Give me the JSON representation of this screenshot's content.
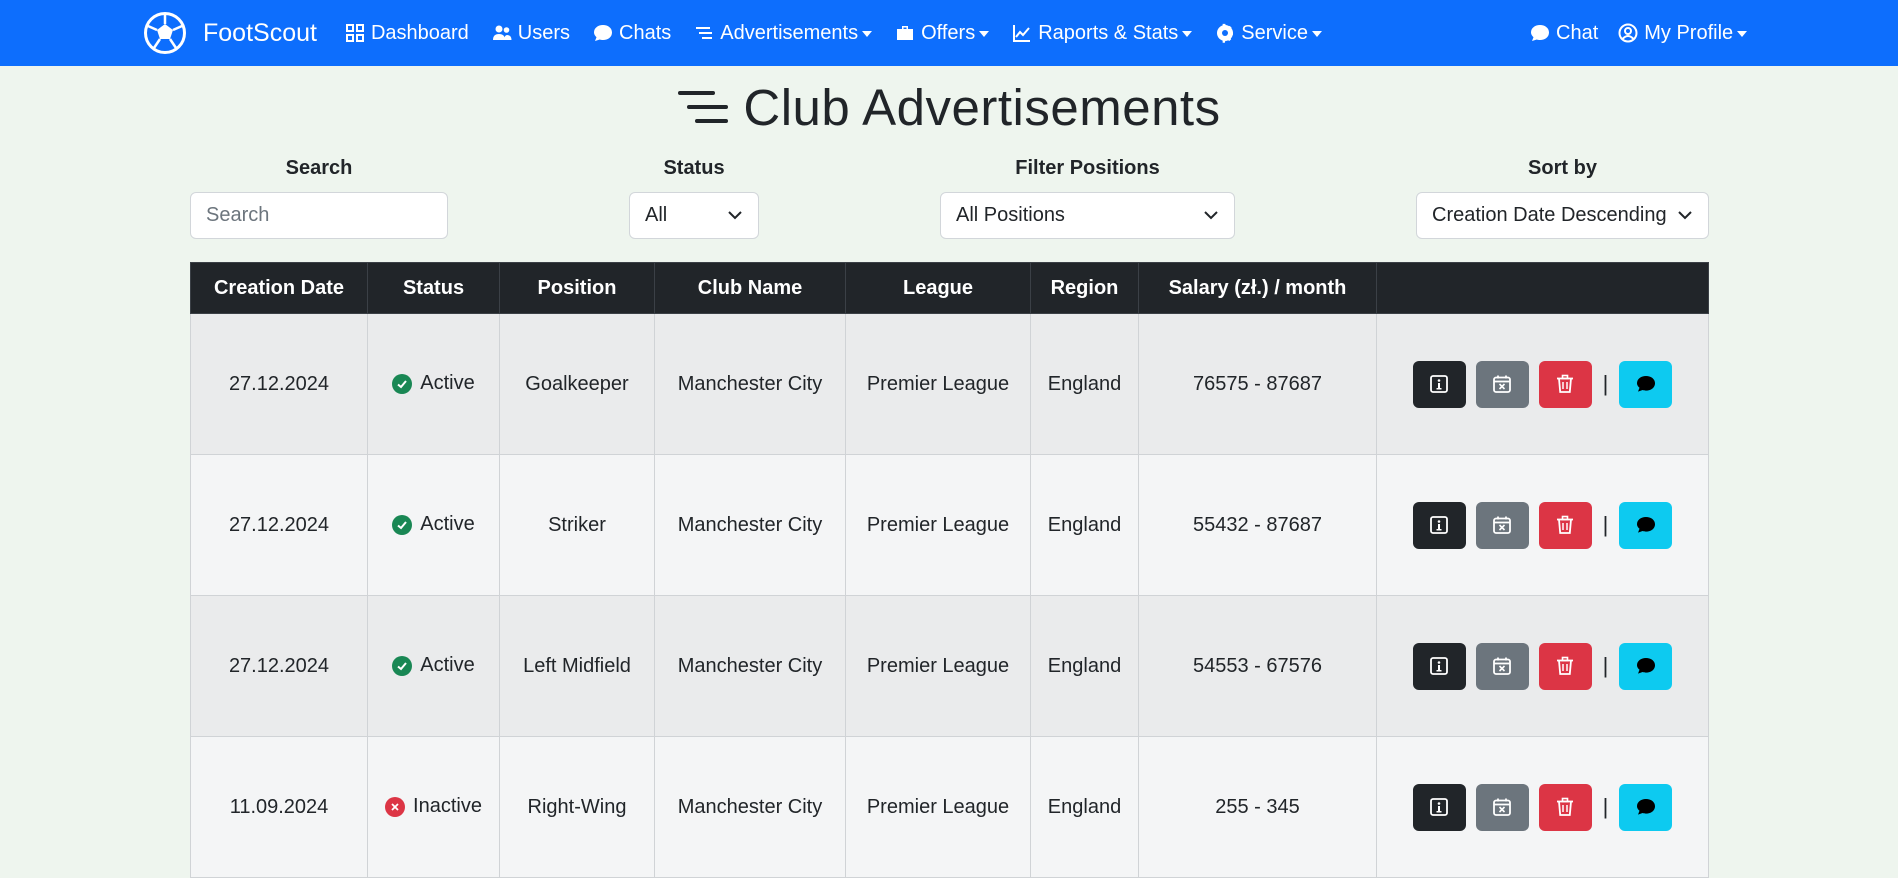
{
  "brand": {
    "name": "FootScout"
  },
  "nav": {
    "items": [
      {
        "label": "Dashboard",
        "icon": "grid-icon",
        "dropdown": false
      },
      {
        "label": "Users",
        "icon": "users-icon",
        "dropdown": false
      },
      {
        "label": "Chats",
        "icon": "chat-icon",
        "dropdown": false
      },
      {
        "label": "Advertisements",
        "icon": "list-icon",
        "dropdown": true
      },
      {
        "label": "Offers",
        "icon": "briefcase-icon",
        "dropdown": true
      },
      {
        "label": "Raports & Stats",
        "icon": "chart-icon",
        "dropdown": true
      },
      {
        "label": "Service",
        "icon": "gear-icon",
        "dropdown": true
      }
    ],
    "right": [
      {
        "label": "Chat",
        "icon": "chat-icon",
        "dropdown": false
      },
      {
        "label": "My Profile",
        "icon": "user-circle-icon",
        "dropdown": true
      }
    ]
  },
  "page": {
    "title": "Club Advertisements"
  },
  "filters": {
    "search": {
      "label": "Search",
      "placeholder": "Search",
      "value": ""
    },
    "status": {
      "label": "Status",
      "value": "All"
    },
    "positions": {
      "label": "Filter Positions",
      "value": "All Positions"
    },
    "sort": {
      "label": "Sort by",
      "value": "Creation Date Descending"
    }
  },
  "table": {
    "headers": [
      "Creation Date",
      "Status",
      "Position",
      "Club Name",
      "League",
      "Region",
      "Salary (zł.) / month",
      ""
    ],
    "rows": [
      {
        "date": "27.12.2024",
        "status": "Active",
        "active": true,
        "position": "Goalkeeper",
        "club": "Manchester City",
        "league": "Premier League",
        "region": "England",
        "salary": "76575 - 87687"
      },
      {
        "date": "27.12.2024",
        "status": "Active",
        "active": true,
        "position": "Striker",
        "club": "Manchester City",
        "league": "Premier League",
        "region": "England",
        "salary": "55432 - 87687"
      },
      {
        "date": "27.12.2024",
        "status": "Active",
        "active": true,
        "position": "Left Midfield",
        "club": "Manchester City",
        "league": "Premier League",
        "region": "England",
        "salary": "54553 - 67576"
      },
      {
        "date": "11.09.2024",
        "status": "Inactive",
        "active": false,
        "position": "Right-Wing",
        "club": "Manchester City",
        "league": "Premier League",
        "region": "England",
        "salary": "255 - 345"
      }
    ],
    "separator": "|"
  },
  "colors": {
    "navbar": "#0d6efd",
    "background": "#eef5ee",
    "active": "#198754",
    "inactive": "#dc3545",
    "btn_info": "#212529",
    "btn_finish": "#6c757d",
    "btn_delete": "#dc3545",
    "btn_chat": "#0dcaf0"
  }
}
